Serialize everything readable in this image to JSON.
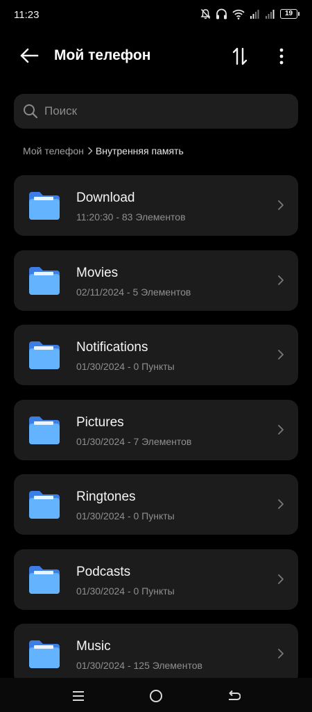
{
  "status_bar": {
    "time": "11:23",
    "battery": "19",
    "icons": [
      "bell-off-icon",
      "headphones-icon",
      "wifi-icon",
      "signal-icon",
      "signal-icon",
      "battery-icon"
    ]
  },
  "header": {
    "title": "Мой телефон",
    "back_icon": "arrow-left-icon",
    "sort_icon": "sort-icon",
    "more_icon": "more-vertical-icon"
  },
  "search": {
    "placeholder": "Поиск",
    "value": ""
  },
  "breadcrumb": {
    "root": "Мой телефон",
    "current": "Внутренняя память"
  },
  "folders": [
    {
      "name": "Download",
      "meta": "11:20:30 - 83 Элементов"
    },
    {
      "name": "Movies",
      "meta": "02/11/2024 - 5 Элементов"
    },
    {
      "name": "Notifications",
      "meta": "01/30/2024 - 0 Пункты"
    },
    {
      "name": "Pictures",
      "meta": "01/30/2024 - 7 Элементов"
    },
    {
      "name": "Ringtones",
      "meta": "01/30/2024 - 0 Пункты"
    },
    {
      "name": "Podcasts",
      "meta": "01/30/2024 - 0 Пункты"
    },
    {
      "name": "Music",
      "meta": "01/30/2024 - 125 Элементов"
    }
  ],
  "nav_bar": {
    "icons": [
      "menu-icon",
      "home-icon",
      "back-icon"
    ]
  },
  "colors": {
    "background": "#000000",
    "card": "#1c1c1c",
    "folder_blue": "#5aaeff",
    "folder_dark_blue": "#3d7ee6",
    "secondary_text": "#8f8f8f"
  }
}
